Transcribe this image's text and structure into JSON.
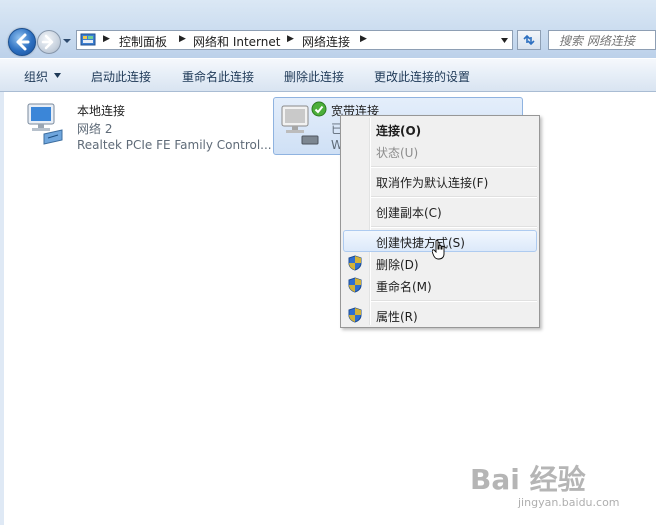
{
  "address_bar": {
    "breadcrumbs": [
      "控制面板",
      "网络和 Internet",
      "网络连接"
    ]
  },
  "search": {
    "placeholder": "搜索 网络连接"
  },
  "toolbar": {
    "organize_label": "组织",
    "enable_label": "启动此连接",
    "rename_label": "重命名此连接",
    "delete_label": "删除此连接",
    "change_settings_label": "更改此连接的设置"
  },
  "connections": [
    {
      "name": "本地连接",
      "network": "网络  2",
      "adapter": "Realtek PCIe FE Family Control..."
    },
    {
      "name": "宽带连接",
      "status_partial": "已",
      "type_partial": "W"
    }
  ],
  "context_menu": {
    "items": [
      {
        "label": "连接(O)",
        "state": "default"
      },
      {
        "label": "状态(U)",
        "state": "disabled"
      },
      {
        "label": "取消作为默认连接(F)",
        "state": "normal"
      },
      {
        "label": "创建副本(C)",
        "state": "normal"
      },
      {
        "label": "创建快捷方式(S)",
        "state": "hover"
      },
      {
        "label": "删除(D)",
        "state": "normal",
        "icon": "shield-icon"
      },
      {
        "label": "重命名(M)",
        "state": "normal",
        "icon": "shield-icon"
      },
      {
        "label": "属性(R)",
        "state": "normal",
        "icon": "shield-icon"
      }
    ]
  },
  "watermark": {
    "brand": "Bai 经验",
    "url": "jingyan.baidu.com"
  },
  "colors": {
    "accent": "#2c6fc0",
    "menu_hover": "#dce9fa",
    "selection": "#cfe0f5"
  }
}
